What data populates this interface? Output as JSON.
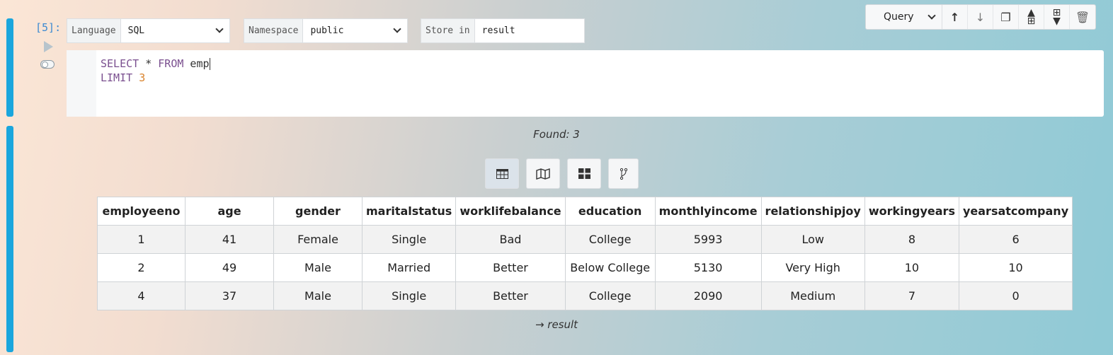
{
  "cell": {
    "index": "[5]:",
    "language": {
      "label": "Language",
      "value": "SQL"
    },
    "namespace": {
      "label": "Namespace",
      "value": "public"
    },
    "store": {
      "label": "Store in",
      "value": "result"
    },
    "code_lines": [
      [
        {
          "t": "SELECT",
          "k": "kw"
        },
        {
          "t": " * ",
          "k": ""
        },
        {
          "t": "FROM",
          "k": "kw"
        },
        {
          "t": " emp",
          "k": ""
        }
      ],
      [
        {
          "t": "LIMIT",
          "k": "kw"
        },
        {
          "t": " ",
          "k": ""
        },
        {
          "t": "3",
          "k": "num"
        }
      ]
    ]
  },
  "toolbar": {
    "mode": "Query",
    "icons": [
      "arrow-up-icon",
      "arrow-down-icon",
      "copy-icon",
      "insert-above-icon",
      "insert-below-icon",
      "trash-icon"
    ]
  },
  "output": {
    "found": "Found: 3",
    "view_icons": [
      "table-icon",
      "map-icon",
      "grid-icon",
      "graph-icon"
    ],
    "columns": [
      "employeeno",
      "age",
      "gender",
      "maritalstatus",
      "worklifebalance",
      "education",
      "monthlyincome",
      "relationshipjoy",
      "workingyears",
      "yearsatcompany"
    ],
    "rows": [
      [
        "1",
        "41",
        "Female",
        "Single",
        "Bad",
        "College",
        "5993",
        "Low",
        "8",
        "6"
      ],
      [
        "2",
        "49",
        "Male",
        "Married",
        "Better",
        "Below College",
        "5130",
        "Very High",
        "10",
        "10"
      ],
      [
        "4",
        "37",
        "Male",
        "Single",
        "Better",
        "College",
        "2090",
        "Medium",
        "7",
        "0"
      ]
    ],
    "result_link": "→ result"
  }
}
